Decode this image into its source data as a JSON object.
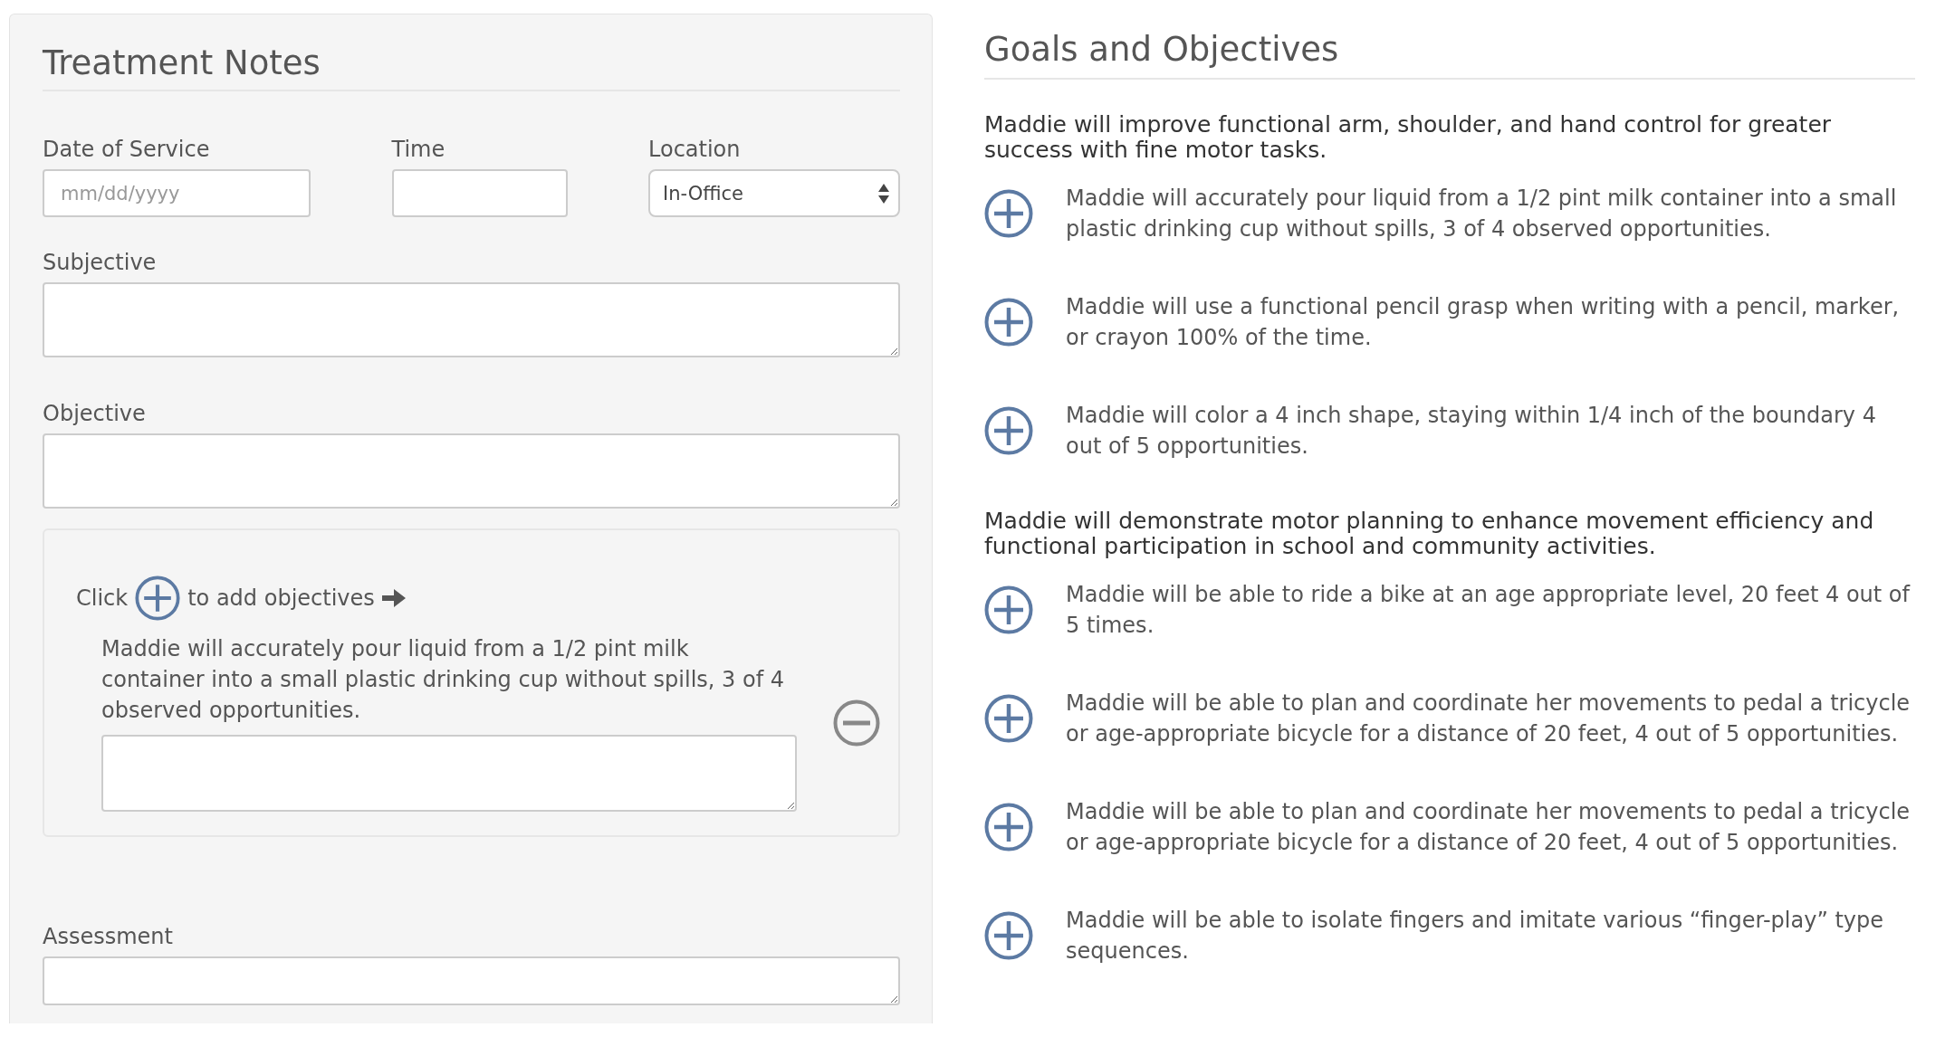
{
  "treatment_notes": {
    "title": "Treatment Notes",
    "top_fields": [
      {
        "kind": "input",
        "label": "Date of Service",
        "placeholder": "mm/dd/yyyy"
      },
      {
        "kind": "input",
        "label": "Time"
      },
      {
        "kind": "select",
        "label": "Location",
        "value": "In-Office"
      }
    ],
    "text_areas": [
      {
        "label": "Subjective"
      },
      {
        "label": "Objective"
      }
    ],
    "objectives_box": {
      "prompt_before": "Click",
      "prompt_after": "to add objectives",
      "added": [
        {
          "text": "Maddie will accurately pour liquid from a 1/2 pint milk container into a small plastic drinking cup without spills, 3 of 4 observed opportunities."
        }
      ]
    },
    "assessment": {
      "label": "Assessment"
    }
  },
  "goals_and_objectives": {
    "title": "Goals and Objectives",
    "goals": [
      {
        "heading": "Maddie will improve functional arm, shoulder, and hand control for greater success with fine motor tasks.",
        "objectives": [
          "Maddie will accurately pour liquid from a 1/2 pint milk container into a small plastic drinking cup without spills, 3 of 4 observed opportunities.",
          "Maddie will use a functional pencil grasp when writing with a pencil, marker, or crayon 100% of the time.",
          "Maddie will color a 4 inch shape, staying within 1/4 inch of the boundary 4 out of 5 opportunities."
        ]
      },
      {
        "heading": "Maddie will demonstrate motor planning to enhance movement efficiency and functional participation in school and community activities.",
        "objectives": [
          "Maddie will be able to ride a bike at an age appropriate level, 20 feet 4 out of 5 times.",
          "Maddie will be able to plan and coordinate her movements to pedal a tricycle or age-appropriate bicycle for a distance of 20 feet, 4 out of 5 opportunities.",
          "Maddie will be able to plan and coordinate her movements to pedal a tricycle or age-appropriate bicycle for a distance of 20 feet, 4 out of 5 opportunities.",
          "Maddie will be able to isolate fingers and imitate various “finger-play” type sequences."
        ]
      }
    ]
  }
}
